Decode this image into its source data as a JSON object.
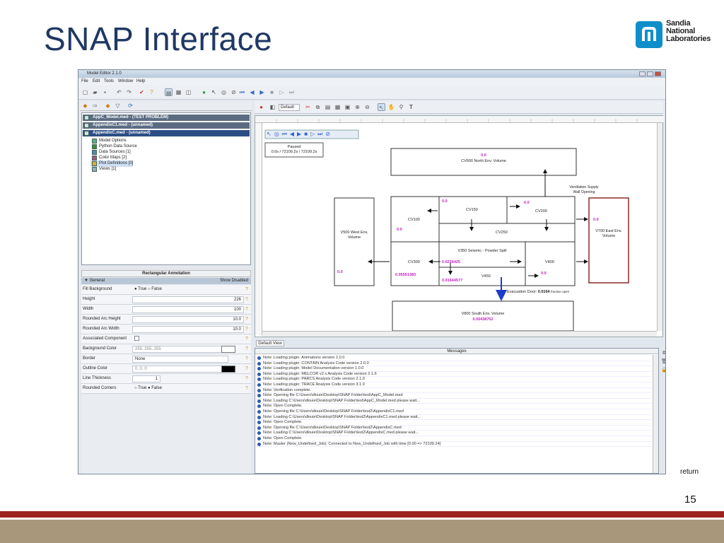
{
  "slide": {
    "title": "SNAP Interface",
    "logo_text": [
      "Sandia",
      "National",
      "Laboratories"
    ],
    "return_label": "return",
    "page_number": "15",
    "colors": {
      "title": "#1f3864",
      "red_band": "#9c2320",
      "tan_band": "#a8977b",
      "logo_blue": "#0e8fc9"
    }
  },
  "app": {
    "window_title": "Model Editor 2.1.0",
    "menu": [
      "File",
      "Edit",
      "Tools",
      "Window",
      "Help"
    ],
    "tree": {
      "rows": [
        {
          "label": "AppC_Model.med - (TEST PROBLEM)",
          "type": "header"
        },
        {
          "label": "AppendixC1.med - (unnamed)",
          "type": "header"
        },
        {
          "label": "AppendixC.med - (unnamed)",
          "type": "header-selected"
        },
        {
          "label": "Model Options",
          "type": "item"
        },
        {
          "label": "Python Data Source",
          "type": "item"
        },
        {
          "label": "Data Sources [1]",
          "type": "item"
        },
        {
          "label": "Color Maps [2]",
          "type": "item"
        },
        {
          "label": "Plot Definitions [0]",
          "type": "item-highlight"
        },
        {
          "label": "Views [1]",
          "type": "item"
        }
      ]
    },
    "properties": {
      "title": "Rectangular Annotation",
      "group": "General",
      "show_disabled": "Show Disabled",
      "rows": [
        {
          "key": "Fill Background",
          "value": "● True  ○ False",
          "kind": "radio"
        },
        {
          "key": "Height",
          "value": "226",
          "kind": "num"
        },
        {
          "key": "Width",
          "value": "100",
          "kind": "num"
        },
        {
          "key": "Rounded Arc Height",
          "value": "10.0",
          "kind": "num"
        },
        {
          "key": "Rounded Arc Width",
          "value": "10.0",
          "kind": "num"
        },
        {
          "key": "Associated Component",
          "value": "",
          "kind": "check"
        },
        {
          "key": "Background Color",
          "value": "255, 255, 255",
          "kind": "color"
        },
        {
          "key": "Border",
          "value": "None",
          "kind": "select"
        },
        {
          "key": "Outline Color",
          "value": "0, 0, 0",
          "kind": "color-black"
        },
        {
          "key": "Line Thickness",
          "value": "1",
          "kind": "spin"
        },
        {
          "key": "Rounded Corners",
          "value": "○ True  ● False",
          "kind": "radio"
        }
      ]
    },
    "canvas": {
      "view_combo": "Default",
      "status": {
        "line1": "Paused",
        "line2": "0.0s / 72109.2s / 72109.2s"
      },
      "boxes": [
        {
          "id": "cv600",
          "label": "CV600 North Env. Volume",
          "value": "0.0"
        },
        {
          "id": "ventilation",
          "label": "Ventilation Supply Wall Opening"
        },
        {
          "id": "cv150",
          "label": "CV150",
          "value": "0.0"
        },
        {
          "id": "cv200",
          "label": "CV200",
          "value": "0.0"
        },
        {
          "id": "cv100",
          "label": "CV100",
          "value": "0.0"
        },
        {
          "id": "cv250",
          "label": "CV250"
        },
        {
          "id": "v500",
          "label": "V500 West Env. Volume",
          "value": "0.0"
        },
        {
          "id": "v700",
          "label": "V700 East Env. Volume",
          "value": "0.0"
        },
        {
          "id": "cv300",
          "label": "CV300",
          "value": "0.05551383"
        },
        {
          "id": "v350",
          "label": "V350 Seismic - Powder Spill",
          "value": "0.0216425"
        },
        {
          "id": "v400",
          "label": "V400",
          "value": "0.0"
        },
        {
          "id": "v450",
          "label": "V450",
          "value": "0.01644577"
        },
        {
          "id": "evac",
          "label": "Evacuation Door:",
          "value": "0.0164",
          "note": "fraction open"
        },
        {
          "id": "v800",
          "label": "V800 South Env. Volume",
          "value": "0.00438752"
        }
      ]
    },
    "tab_label": "Default View",
    "messages_header": "Messages",
    "messages": [
      "Note: Loading plugin: Animations version 2.0.0",
      "Note: Loading plugin: CONTAIN Analysis Code version 2.0.0",
      "Note: Loading plugin: Model Documentation version 1.0.0",
      "Note: Loading plugin: MELCOR v2.x Analysis Code version 2.1.6",
      "Note: Loading plugin: PARCS Analysis Code version 2.1.0",
      "Note: Loading plugin: TRACE Analysis Code version 3.1.0",
      "Note: Verification complete.",
      "Note: Opening file C:\\Users\\dlouie\\Desktop\\SNAP Folder\\test\\AppC_Model.med",
      "Note: Loading C:\\Users\\dlouie\\Desktop\\SNAP Folder\\test\\AppC_Model.med please wait...",
      "Note: Open Complete.",
      "Note: Opening file C:\\Users\\dlouie\\Desktop\\SNAP Folder\\test2\\AppendixC1.med",
      "Note: Loading C:\\Users\\dlouie\\Desktop\\SNAP Folder\\test2\\AppendixC1.med please wait...",
      "Note: Open Complete.",
      "Note: Opening file C:\\Users\\dlouie\\Desktop\\SNAP Folder\\test2\\AppendixC.med",
      "Note: Loading C:\\Users\\dlouie\\Desktop\\SNAP Folder\\test2\\AppendixC.med please wait...",
      "Note: Open Complete.",
      "Note: Master (New_Undefined_Job): Connected to New_Undefined_Job with time [0.00 => 72109.24]"
    ]
  }
}
